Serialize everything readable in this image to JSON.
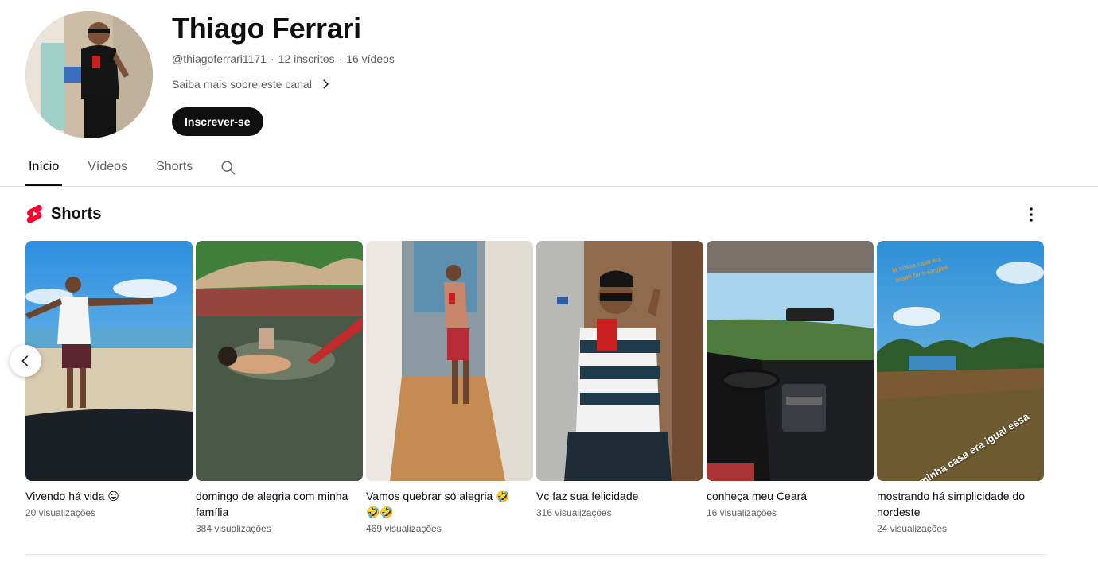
{
  "channel": {
    "name": "Thiago Ferrari",
    "handle": "@thiagoferrari1171",
    "subscribers": "12 inscritos",
    "videos": "16 vídeos",
    "separator": "·",
    "about": "Saiba mais sobre este canal",
    "subscribe_label": "Inscrever-se"
  },
  "tabs": [
    {
      "label": "Início",
      "active": true
    },
    {
      "label": "Vídeos",
      "active": false
    },
    {
      "label": "Shorts",
      "active": false
    }
  ],
  "shelf": {
    "title": "Shorts",
    "items": [
      {
        "title": "Vivendo há vida 😛",
        "views": "20 visualizações"
      },
      {
        "title": "domingo de alegria com minha família",
        "views": "384 visualizações"
      },
      {
        "title": "Vamos quebrar só alegria 🤣🤣🤣",
        "views": "469 visualizações"
      },
      {
        "title": "Vc faz sua felicidade",
        "views": "316 visualizações"
      },
      {
        "title": "conheça meu Ceará",
        "views": "16 visualizações"
      },
      {
        "title": "mostrando há simplicidade do nordeste",
        "views": "24 visualizações",
        "overlay_text": "minha casa era igual essa"
      }
    ]
  },
  "icons": {
    "search": "search-icon",
    "chevron": "chevron-right-icon",
    "more": "more-vertical-icon",
    "prev": "chevron-left-icon",
    "shorts": "shorts-logo-icon"
  },
  "colors": {
    "shorts_red": "#ff0033",
    "button_bg": "#0f0f0f",
    "secondary_text": "#606060"
  }
}
